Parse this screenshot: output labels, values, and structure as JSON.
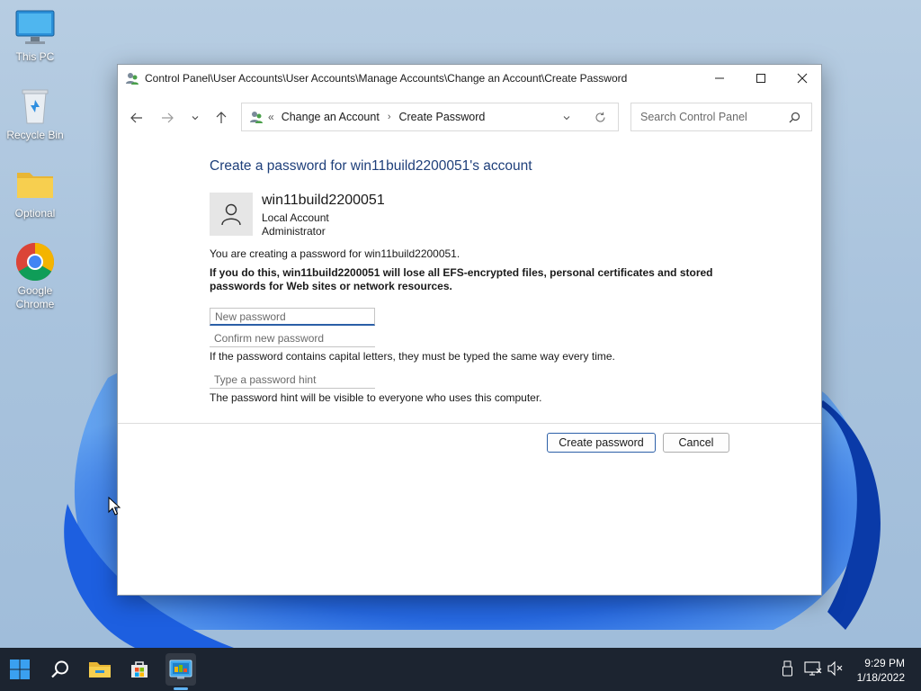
{
  "desktop": {
    "icons": [
      {
        "label": "This PC",
        "icon": "monitor-icon"
      },
      {
        "label": "Recycle Bin",
        "icon": "recycle-bin-icon"
      },
      {
        "label": "Optional",
        "icon": "folder-icon"
      },
      {
        "label": "Google Chrome",
        "icon": "chrome-icon"
      }
    ]
  },
  "window": {
    "title": "Control Panel\\User Accounts\\User Accounts\\Manage Accounts\\Change an Account\\Create Password",
    "address": {
      "overflow": "«",
      "crumbs": [
        "Change an Account",
        "Create Password"
      ]
    },
    "search": {
      "placeholder": "Search Control Panel"
    }
  },
  "page": {
    "heading": "Create a password for win11build2200051's account",
    "account": {
      "name": "win11build2200051",
      "type": "Local Account",
      "role": "Administrator"
    },
    "intro": "You are creating a password for win11build2200051.",
    "warning": "If you do this, win11build2200051 will lose all EFS-encrypted files, personal certificates and stored passwords for Web sites or network resources.",
    "new_password": {
      "placeholder": "New password",
      "value": ""
    },
    "confirm_password": {
      "placeholder": "Confirm new password",
      "value": ""
    },
    "caps_note": "If the password contains capital letters, they must be typed the same way every time.",
    "hint": {
      "placeholder": "Type a password hint",
      "value": ""
    },
    "hint_note": "The password hint will be visible to everyone who uses this computer.",
    "create_button": "Create password",
    "cancel_button": "Cancel"
  },
  "taskbar": {
    "time": "9:29 PM",
    "date": "1/18/2022"
  },
  "colors": {
    "heading": "#1e3f7a",
    "accent": "#2b5fa7",
    "taskbar": "#1c2430"
  }
}
